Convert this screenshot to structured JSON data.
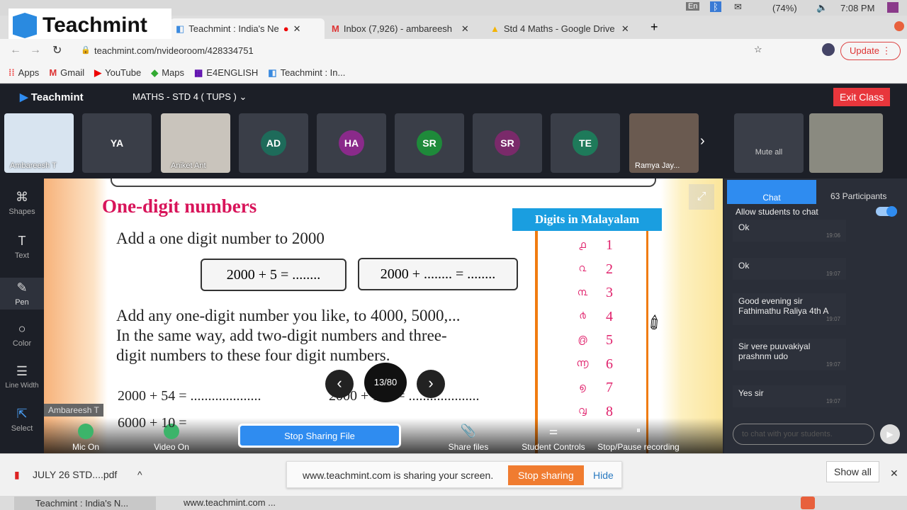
{
  "os": {
    "battery": "(74%)",
    "time": "7:08 PM",
    "lang": "En"
  },
  "overlay_logo": "Teachmint",
  "tabs": [
    {
      "title": "Teachmint : India's Ne",
      "active": true
    },
    {
      "title": "Inbox (7,926) - ambareesh"
    },
    {
      "title": "Std 4 Maths - Google Drive"
    }
  ],
  "address": {
    "url": "teachmint.com/nvideoroom/428334751",
    "update_label": "Update"
  },
  "bookmarks": [
    "Apps",
    "Gmail",
    "YouTube",
    "Maps",
    "E4ENGLISH",
    "Teachmint : In..."
  ],
  "app": {
    "brand": "Teachmint",
    "class_name": "MATHS - STD 4 ( TUPS )",
    "exit_label": "Exit Class"
  },
  "participants": [
    {
      "label": "Ambareesh T",
      "type": "screen"
    },
    {
      "initials": "YA",
      "color": "#3a3e48"
    },
    {
      "label": "Aniket Ant",
      "type": "video"
    },
    {
      "initials": "AD",
      "color": "#1e6b5a"
    },
    {
      "initials": "HA",
      "color": "#8a2a8a"
    },
    {
      "initials": "SR",
      "color": "#1e8a3a"
    },
    {
      "initials": "SR",
      "color": "#7a2a6a"
    },
    {
      "initials": "TE",
      "color": "#1e7a5a"
    },
    {
      "label": "Ramya Jay...",
      "type": "video"
    }
  ],
  "mute_all": "Mute all",
  "tools": [
    "Shapes",
    "Text",
    "Pen",
    "Color",
    "Line Width",
    "Select"
  ],
  "slide": {
    "title": "One-digit numbers",
    "line1": "Add a one digit number to 2000",
    "box1": "2000 + 5 = ........",
    "box2": "2000 +  ........ = ........",
    "para": [
      "Add any one-digit number you like, to 4000, 5000,...",
      "In the same way, add two-digit numbers and three-",
      "digit numbers to these four digit numbers."
    ],
    "eq1": "2000 + 54 = ....................",
    "eq2": "2000 + 103 = ....................",
    "eq3": "6000 + 10 = ",
    "panel_title": "Digits in Malayalam",
    "digits": [
      [
        "൧",
        "1"
      ],
      [
        "൨",
        "2"
      ],
      [
        "൩",
        "3"
      ],
      [
        "൪",
        "4"
      ],
      [
        "൫",
        "5"
      ],
      [
        "൬",
        "6"
      ],
      [
        "൭",
        "7"
      ],
      [
        "൮",
        "8"
      ]
    ],
    "page": "13/80",
    "presenter_tag": "Ambareesh T"
  },
  "controls": {
    "mic": "Mic On",
    "video": "Video On",
    "stop_file": "Stop Sharing File",
    "share": "Share files",
    "student": "Student Controls",
    "record": "Stop/Pause recording"
  },
  "chat": {
    "tab_chat": "Chat",
    "tab_participants": "63 Participants",
    "allow": "Allow students to chat",
    "allow_on": true,
    "messages": [
      {
        "text": "Ok",
        "time": "19:06"
      },
      {
        "text": "Ok",
        "time": "19:07"
      },
      {
        "text": "Good evening sir\nFathimathu Raliya 4th A",
        "time": "19:07"
      },
      {
        "text": "Sir vere puuvakiyal\nprashnm udo",
        "time": "19:07"
      },
      {
        "text": "Yes sir",
        "time": "19:07"
      }
    ],
    "placeholder": "to chat with your students."
  },
  "download": {
    "file": "JULY 26 STD....pdf",
    "sharing_msg": "www.teachmint.com is sharing your screen.",
    "stop_sharing": "Stop sharing",
    "hide": "Hide",
    "show_all": "Show all"
  },
  "taskbar": [
    "Teachmint : India's N...",
    "www.teachmint.com ..."
  ],
  "colors": {
    "accent": "#2f8cf0",
    "exit": "#e8363c",
    "stop_sharing": "#f07c30",
    "slide_title": "#d8145a"
  }
}
